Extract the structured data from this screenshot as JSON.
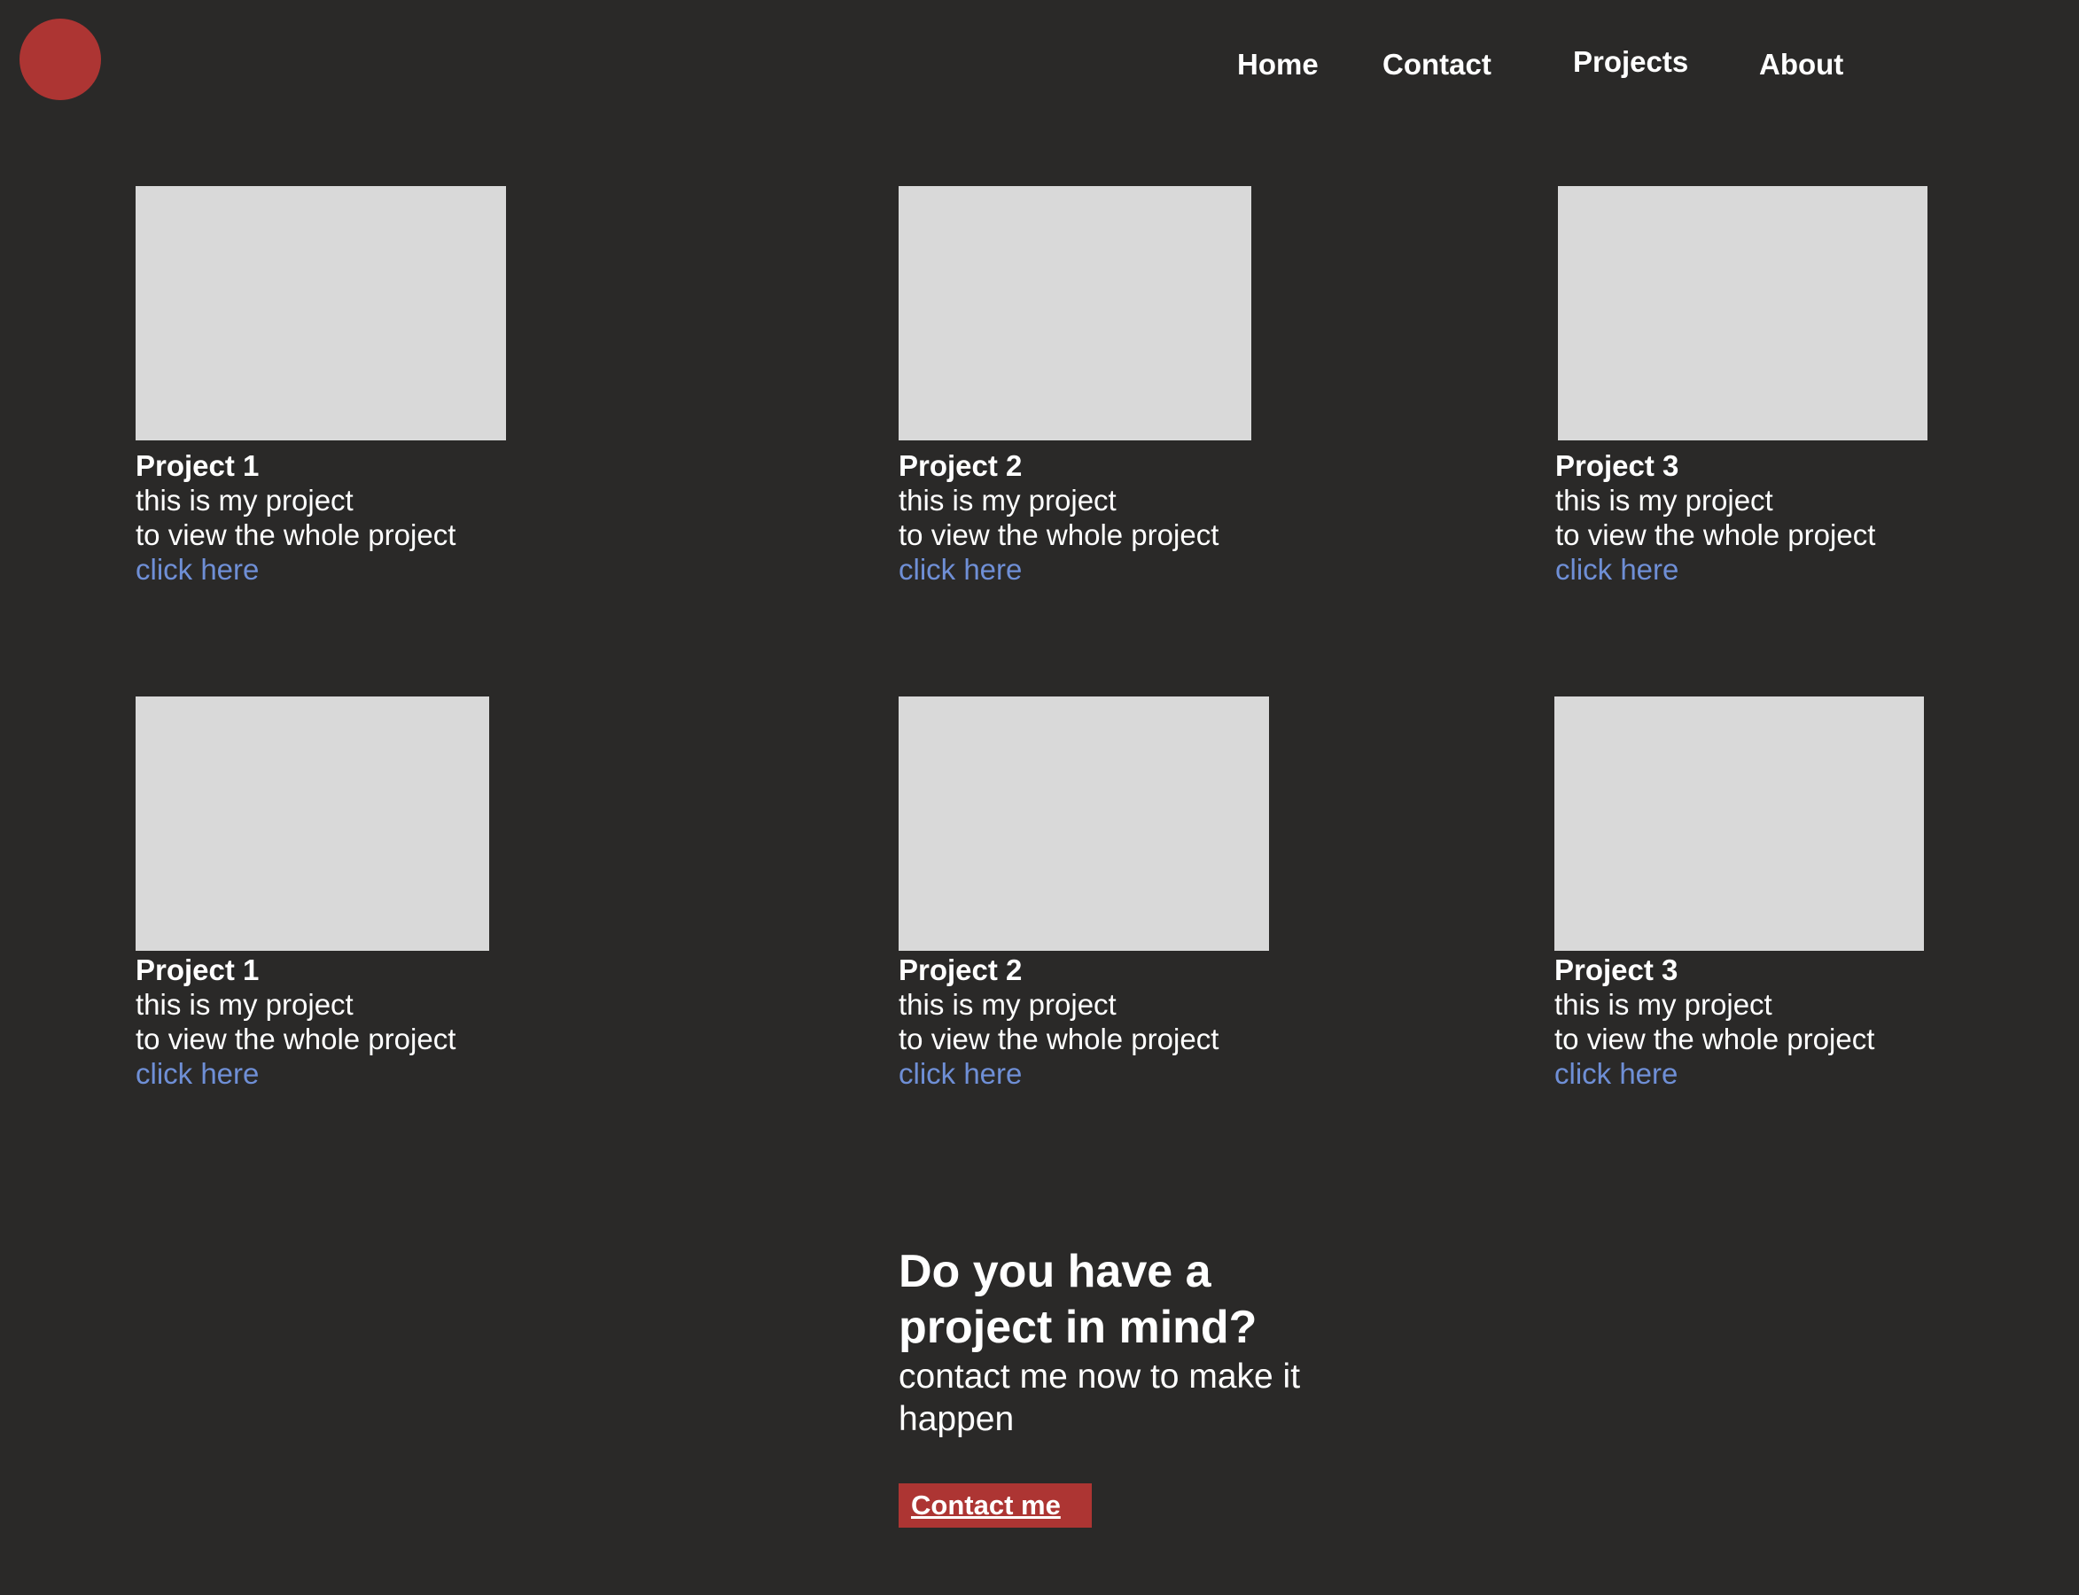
{
  "header": {
    "nav": [
      "Home",
      "Contact",
      "Projects",
      "About"
    ]
  },
  "projects": [
    {
      "title": "Project 1",
      "desc": "this is my project",
      "note": "to view the whole project",
      "link": "click here"
    },
    {
      "title": "Project 2",
      "desc": "this is my project",
      "note": "to view the whole project",
      "link": "click here"
    },
    {
      "title": "Project 3",
      "desc": "this is my project",
      "note": "to view the whole project",
      "link": "click here"
    },
    {
      "title": "Project 1",
      "desc": "this is my project",
      "note": "to view the whole project",
      "link": "click here"
    },
    {
      "title": "Project 2",
      "desc": "this is my project",
      "note": "to view the whole project",
      "link": "click here"
    },
    {
      "title": "Project 3",
      "desc": "this is my project",
      "note": "to view the whole project",
      "link": "click here"
    }
  ],
  "cta": {
    "title_line1": "Do you have a",
    "title_line2": "project in mind?",
    "sub_line1": "contact me now to make it",
    "sub_line2": "happen",
    "button": "Contact me"
  },
  "colors": {
    "background": "#2a2928",
    "accent": "#ad3533",
    "link": "#6f8fd6",
    "placeholder": "#d9d9d9"
  }
}
